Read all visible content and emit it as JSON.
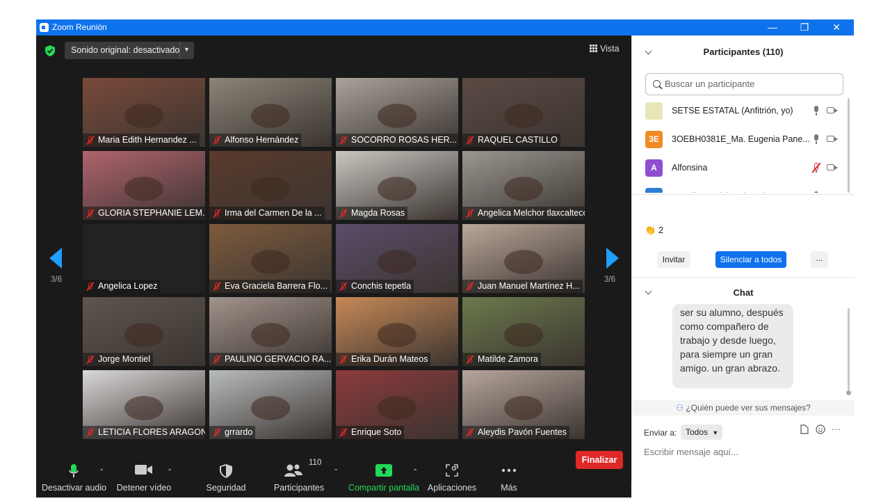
{
  "window": {
    "title": "Zoom Reunión",
    "controls": [
      "—",
      "❐",
      "✕"
    ]
  },
  "meeting": {
    "sound_button": "Sonido original: desactivado",
    "view_button": "Vista",
    "page_left": "3/6",
    "page_right": "3/6",
    "accent": "#1f9fff"
  },
  "tiles": [
    {
      "name": "Maria Edith Hernandez ...",
      "bg": "#7a4a3a"
    },
    {
      "name": "Alfonso Hernández",
      "bg": "#8a8478"
    },
    {
      "name": "SOCORRO ROSAS HER...",
      "bg": "#a9a39a"
    },
    {
      "name": "RAQUEL CASTILLO",
      "bg": "#5b4a44"
    },
    {
      "name": "GLORIA STEPHANIE LEM...",
      "bg": "#b0636e"
    },
    {
      "name": "Irma del Carmen De la ...",
      "bg": "#5a3b2c"
    },
    {
      "name": "Magda Rosas",
      "bg": "#c9c6c0"
    },
    {
      "name": "Angelica Melchor tlaxcalteco",
      "bg": "#9a9690"
    },
    {
      "name": "Angelica Lopez",
      "bg": "#222222"
    },
    {
      "name": "Eva Graciela Barrera Flo...",
      "bg": "#7d5b3d"
    },
    {
      "name": "Conchis  tepetla",
      "bg": "#5a4d6a"
    },
    {
      "name": "Juan Manuel Martínez H...",
      "bg": "#b9a79a"
    },
    {
      "name": "Jorge Montiel",
      "bg": "#5e554d"
    },
    {
      "name": "PAULINO GERVACIO RA...",
      "bg": "#a0938a"
    },
    {
      "name": "Erika Durán Mateos",
      "bg": "#c78956"
    },
    {
      "name": "Matilde Zamora",
      "bg": "#6b7a4c"
    },
    {
      "name": "LETICIA FLORES ARAGON",
      "bg": "#dad8d8"
    },
    {
      "name": "grrardo",
      "bg": "#b8bcbc"
    },
    {
      "name": "Enrique Soto",
      "bg": "#8c3a3c"
    },
    {
      "name": "Aleydis Pavón Fuentes",
      "bg": "#b6a69d"
    }
  ],
  "toolbar": {
    "audio": "Desactivar audio",
    "video": "Detener vídeo",
    "security": "Seguridad",
    "participants": "Participantes",
    "participants_count": "110",
    "share": "Compartir pantalla",
    "apps": "Aplicaciones",
    "more": "Más",
    "end": "Finalizar"
  },
  "participants_panel": {
    "title": "Participantes (110)",
    "search_placeholder": "Buscar un participante",
    "items": [
      {
        "avatar": "",
        "name": "SETSE ESTATAL (Anfitrión, yo)",
        "color": "#e6e6b8",
        "muted": false
      },
      {
        "avatar": "3E",
        "name": "3OEBH0381E_Ma. Eugenia Pane...",
        "color": "#f08a24",
        "muted": false
      },
      {
        "avatar": "A",
        "name": "Alfonsina",
        "color": "#8f4fcf",
        "muted": true
      },
      {
        "avatar": "",
        "name": "Angelica Melchor tlaxcalteco",
        "color": "#2b7fd4",
        "muted": false
      }
    ],
    "reaction_count": "2",
    "invite": "Invitar",
    "mute_all": "Silenciar a todos",
    "more": "..."
  },
  "chat": {
    "title": "Chat",
    "message": "Cordobal Fue un honor ser su alumno, después como compañero de trabajo y desde luego, para siempre un gran amigo. un gran abrazo.",
    "visibility": "¿Quién puede ver sus mensajes?",
    "send_to_label": "Enviar a:",
    "send_to_value": "Todos",
    "placeholder": "Escribir mensaje aquí..."
  }
}
